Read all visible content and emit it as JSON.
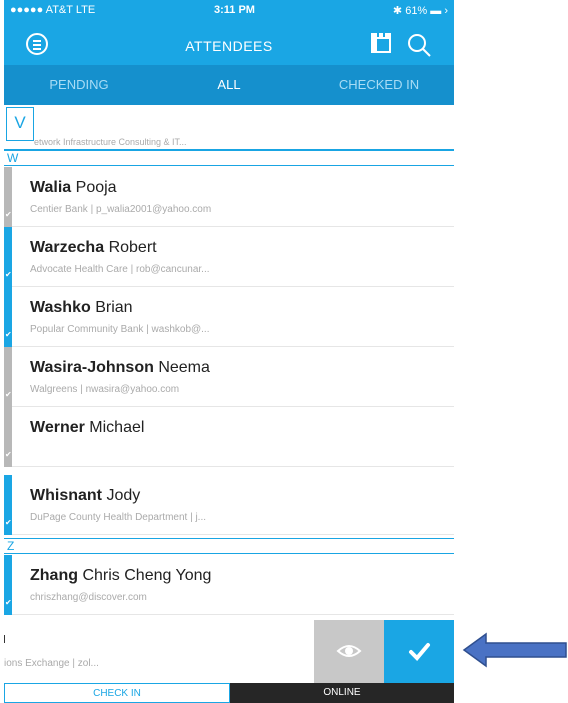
{
  "status_bar": {
    "carrier": "●●●●● AT&T  LTE",
    "time": "3:11 PM",
    "battery": "✱ 61% ▬ ›"
  },
  "header": {
    "title": "ATTENDEES"
  },
  "tabs": [
    {
      "label": "PENDING",
      "active": false
    },
    {
      "label": "ALL",
      "active": true
    },
    {
      "label": "CHECKED IN",
      "active": false
    }
  ],
  "partial_row": {
    "section_index": "V",
    "sub": "etwork Infrastructure Consulting & IT..."
  },
  "sections": {
    "w": "W",
    "z": "Z"
  },
  "attendees": [
    {
      "last": "Walia",
      "first": "Pooja",
      "sub": "Centier Bank | p_walia2001@yahoo.com",
      "checked_in": false
    },
    {
      "last": "Warzecha",
      "first": "Robert",
      "sub": "Advocate Health Care | rob@cancunar...",
      "checked_in": true
    },
    {
      "last": "Washko",
      "first": "Brian",
      "sub": "Popular Community Bank | washkob@...",
      "checked_in": true
    },
    {
      "last": "Wasira-Johnson",
      "first": "Neema",
      "sub": "Walgreens | nwasira@yahoo.com",
      "checked_in": false
    },
    {
      "last": "Werner",
      "first": "Michael",
      "sub": "",
      "checked_in": false
    },
    {
      "last": "Whisnant",
      "first": "Jody",
      "sub": "DuPage County Health Department | j...",
      "checked_in": true
    },
    {
      "last": "Zhang",
      "first": "Chris Cheng Yong",
      "sub": "chriszhang@discover.com",
      "checked_in": true
    }
  ],
  "swipe_row": {
    "sub": "ions Exchange | zol..."
  },
  "bottom_tabs": {
    "check_in": "CHECK IN",
    "online": "ONLINE"
  },
  "colors": {
    "accent": "#1aa6e4",
    "tab_bar": "#1590cd",
    "pending_stripe": "#b8b8b8",
    "arrow": "#4a72c4"
  }
}
